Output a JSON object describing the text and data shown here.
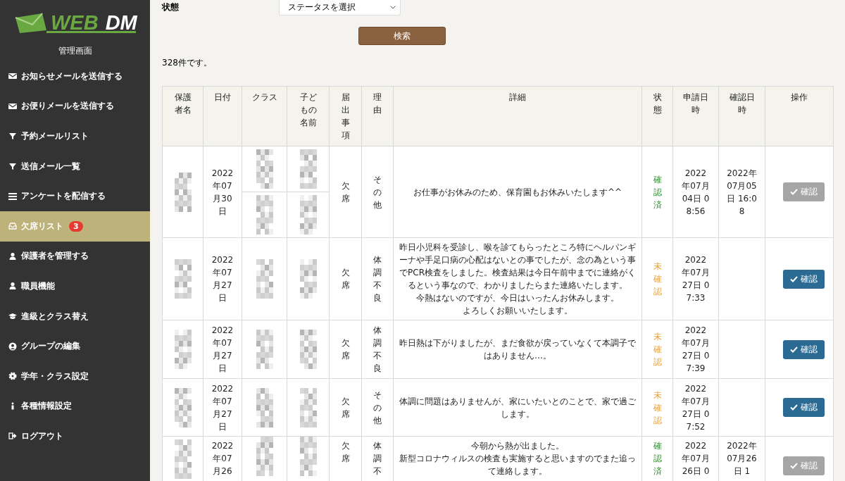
{
  "sidebar": {
    "logo": {
      "part_1": "WEB",
      "part_2": "DM"
    },
    "heading": "管理画面",
    "items": [
      {
        "label": "お知らせメールを送信する",
        "kind": "envelope",
        "selected": false
      },
      {
        "label": "お便りメールを送信する",
        "kind": "envelope",
        "selected": false
      },
      {
        "label": "予約メールリスト",
        "kind": "filter",
        "selected": false
      },
      {
        "label": "送信メール一覧",
        "kind": "filter",
        "selected": false
      },
      {
        "label": "アンケートを配信する",
        "kind": "list",
        "selected": false
      },
      {
        "label": "欠席リスト",
        "kind": "inbox",
        "selected": true,
        "badge": "3"
      },
      {
        "label": "保護者を管理する",
        "kind": "user",
        "selected": false
      },
      {
        "label": "職員機能",
        "kind": "user",
        "selected": false
      },
      {
        "label": "進級とクラス替え",
        "kind": "cap",
        "selected": false
      },
      {
        "label": "グループの編集",
        "kind": "group",
        "selected": false
      },
      {
        "label": "学年・クラス設定",
        "kind": "gear",
        "selected": false
      },
      {
        "label": "各種情報設定",
        "kind": "info",
        "selected": false
      },
      {
        "label": "ログアウト",
        "kind": "logout",
        "selected": false
      }
    ]
  },
  "filter": {
    "label": "状態",
    "select": {
      "value": "ステータスを選択"
    },
    "search_button": "検索"
  },
  "result_count": "328件です。",
  "table": {
    "columns": [
      "保護者名",
      "日付",
      "クラス",
      "子どもの名前",
      "届出事項",
      "理由",
      "詳細",
      "状態",
      "申請日時",
      "確認日時",
      "操作"
    ],
    "rows": [
      {
        "split": true,
        "date": "2022年07月30日",
        "type": "欠席",
        "reason": "その他",
        "detail": [
          "お仕事がお休みのため、保育園もお休みいたします^^"
        ],
        "status": {
          "kind": "confirmed",
          "label": "確認済"
        },
        "applied": "2022年07月04日 08:56",
        "confirmed": "2022年07月05日 16:08",
        "action": {
          "label": "確認",
          "disabled": true
        }
      },
      {
        "split": false,
        "date": "2022年07月27日",
        "type": "欠席",
        "reason": "体調不良",
        "detail": [
          "昨日小児科を受診し、喉を診てもらったところ特にヘルパンギーナや手足口病の心配はないとの事でしたが、念の為という事でPCR検査をしました。検査結果は今日午前中までに連絡がくるという事なので、わかりましたらまた連絡いたします。",
          "今熱はないのですが、今日はいったんお休みします。",
          "よろしくお願いいたします。"
        ],
        "status": {
          "kind": "unconfirmed",
          "label": "未確認"
        },
        "applied": "2022年07月27日 07:33",
        "action": {
          "label": "確認",
          "disabled": false
        }
      },
      {
        "split": false,
        "date": "2022年07月27日",
        "type": "欠席",
        "reason": "体調不良",
        "detail": [
          "昨日熱は下がりましたが、まだ食欲が戻っていなくて本調子ではありません…。"
        ],
        "status": {
          "kind": "unconfirmed",
          "label": "未確認"
        },
        "applied": "2022年07月27日 07:39",
        "action": {
          "label": "確認",
          "disabled": false
        }
      },
      {
        "split": false,
        "date": "2022年07月27日",
        "type": "欠席",
        "reason": "その他",
        "detail": [
          "体調に問題はありませんが、家にいたいとのことで、家で過ごします。"
        ],
        "status": {
          "kind": "unconfirmed",
          "label": "未確認"
        },
        "applied": "2022年07月27日 07:52",
        "action": {
          "label": "確認",
          "disabled": false
        }
      },
      {
        "split": false,
        "date": "2022年07月26",
        "type": "欠席",
        "reason": "体調不",
        "detail": [
          "今朝から熱が出ました。",
          "新型コロナウィルスの検査も実施すると思いますのでまた追って連絡します。"
        ],
        "status": {
          "kind": "confirmed",
          "label": "確認済"
        },
        "applied": "2022年07月26日 0",
        "confirmed": "2022年07月26日 1",
        "action": {
          "label": "確認",
          "disabled": true
        }
      }
    ]
  }
}
